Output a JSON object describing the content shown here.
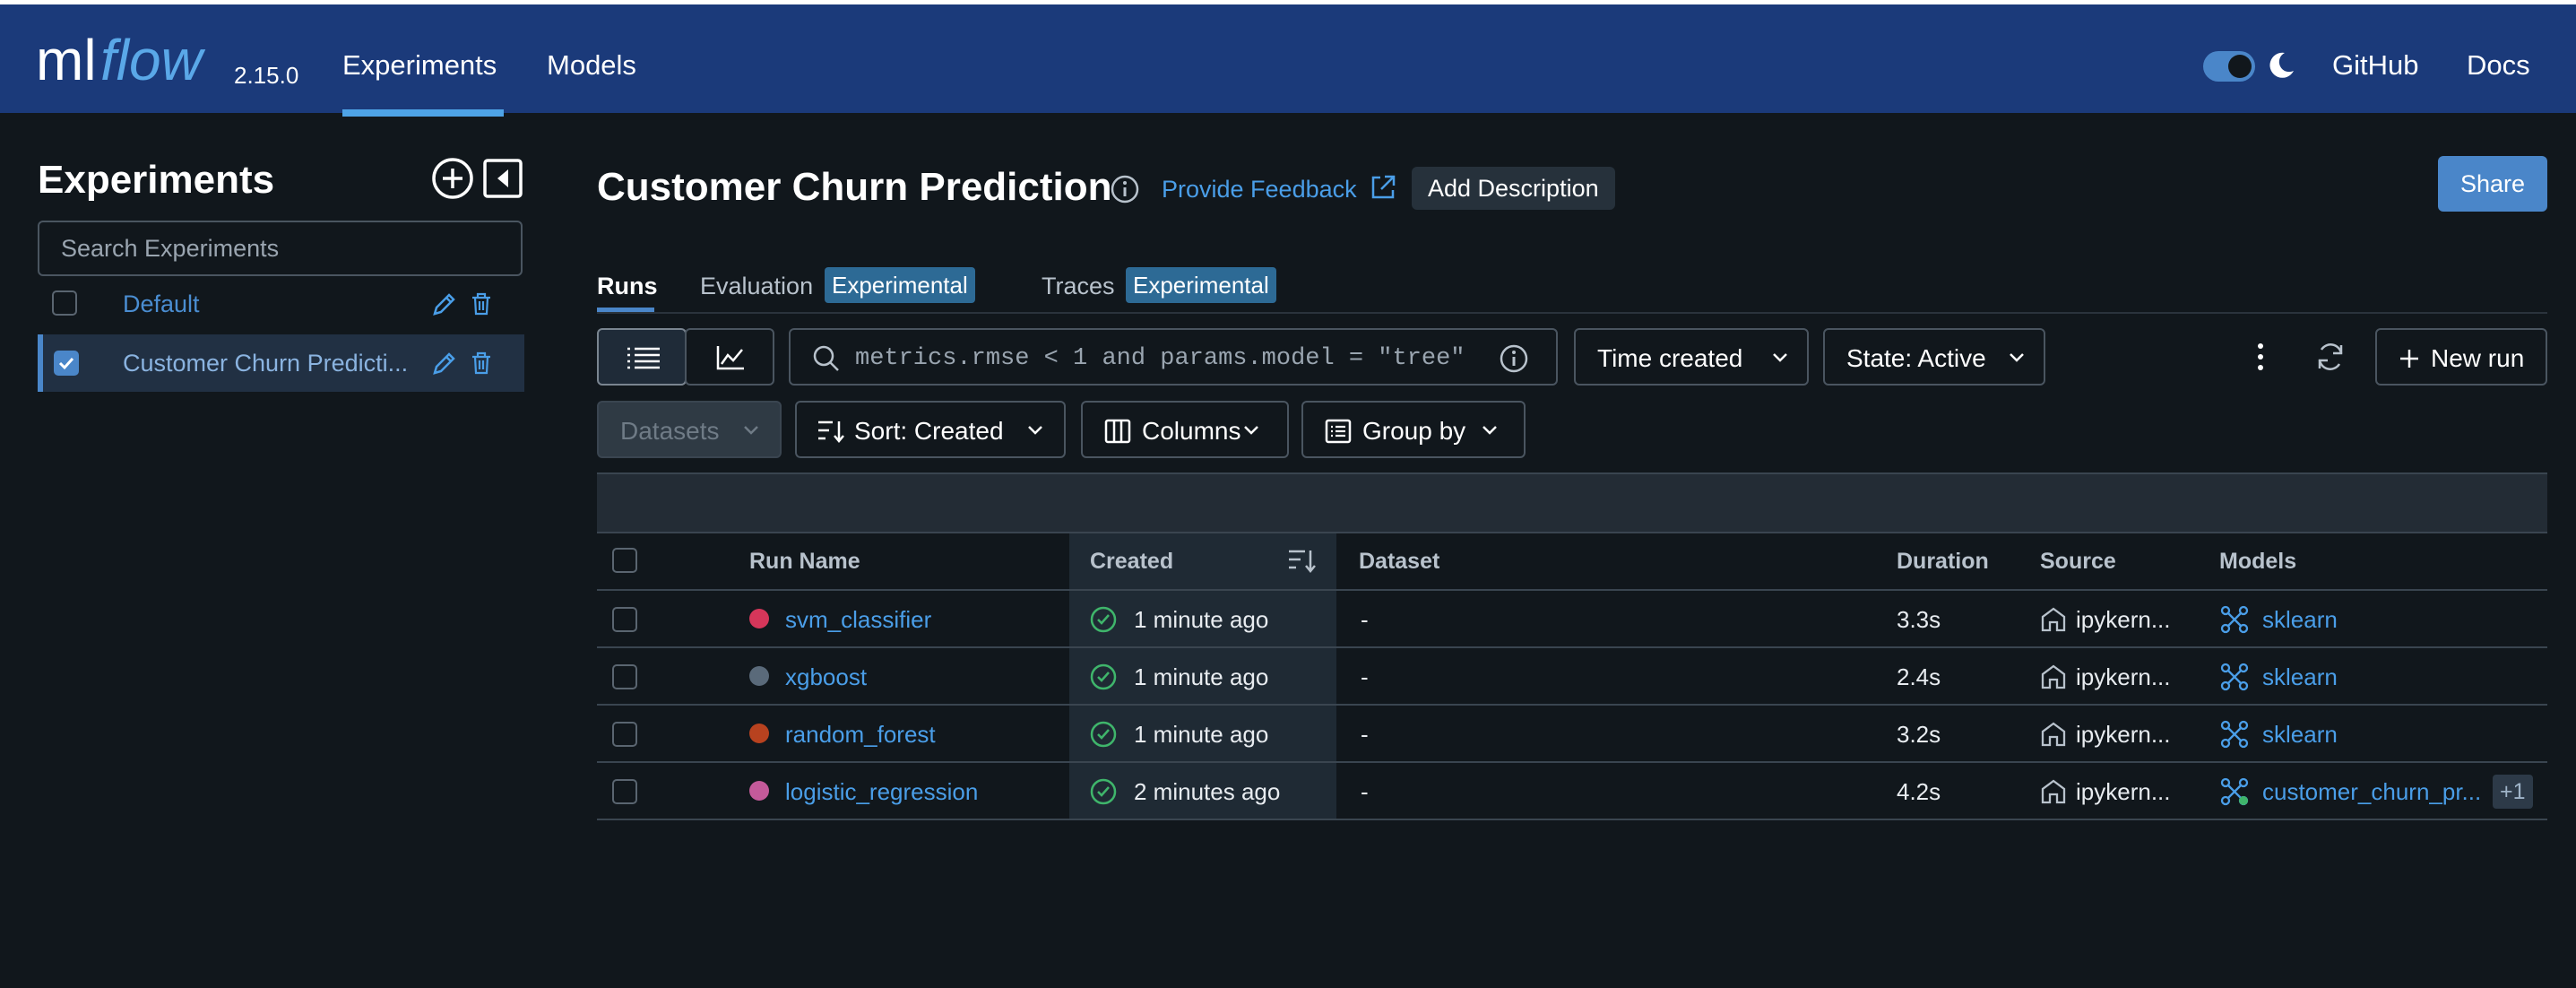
{
  "header": {
    "version": "2.15.0",
    "nav": [
      "Experiments",
      "Models"
    ],
    "links": [
      "GitHub",
      "Docs"
    ],
    "theme_toggle_on": true
  },
  "sidebar": {
    "title": "Experiments",
    "search_placeholder": "Search Experiments",
    "experiments": [
      {
        "name": "Default",
        "checked": false
      },
      {
        "name": "Customer Churn Predicti...",
        "checked": true
      }
    ]
  },
  "main": {
    "title": "Customer Churn Prediction",
    "feedback": "Provide Feedback",
    "add_description": "Add Description",
    "share": "Share",
    "tabs": [
      {
        "label": "Runs",
        "badge": ""
      },
      {
        "label": "Evaluation",
        "badge": "Experimental"
      },
      {
        "label": "Traces",
        "badge": "Experimental"
      }
    ],
    "filter": "metrics.rmse < 1 and params.model = \"tree\"",
    "time_created": "Time created",
    "state": "State: Active",
    "new_run": "New run",
    "datasets": "Datasets",
    "sort": "Sort: Created",
    "columns": "Columns",
    "group_by": "Group by"
  },
  "table": {
    "headers": [
      "Run Name",
      "Created",
      "Dataset",
      "Duration",
      "Source",
      "Models"
    ],
    "rows": [
      {
        "name": "svm_classifier",
        "color": "#d6365a",
        "created": "1 minute ago",
        "dataset": "-",
        "duration": "3.3s",
        "source": "ipykern...",
        "model": "sklearn",
        "extra": ""
      },
      {
        "name": "xgboost",
        "color": "#5a6a7a",
        "created": "1 minute ago",
        "dataset": "-",
        "duration": "2.4s",
        "source": "ipykern...",
        "model": "sklearn",
        "extra": ""
      },
      {
        "name": "random_forest",
        "color": "#b8421f",
        "created": "1 minute ago",
        "dataset": "-",
        "duration": "3.2s",
        "source": "ipykern...",
        "model": "sklearn",
        "extra": ""
      },
      {
        "name": "logistic_regression",
        "color": "#c45a9a",
        "created": "2 minutes ago",
        "dataset": "-",
        "duration": "4.2s",
        "source": "ipykern...",
        "model": "customer_churn_pr...",
        "extra": "+1"
      }
    ]
  },
  "colors": {
    "header": "#1b3a7a",
    "accent": "#4a86c9",
    "link": "#4a9ee8",
    "background": "#11171c"
  }
}
